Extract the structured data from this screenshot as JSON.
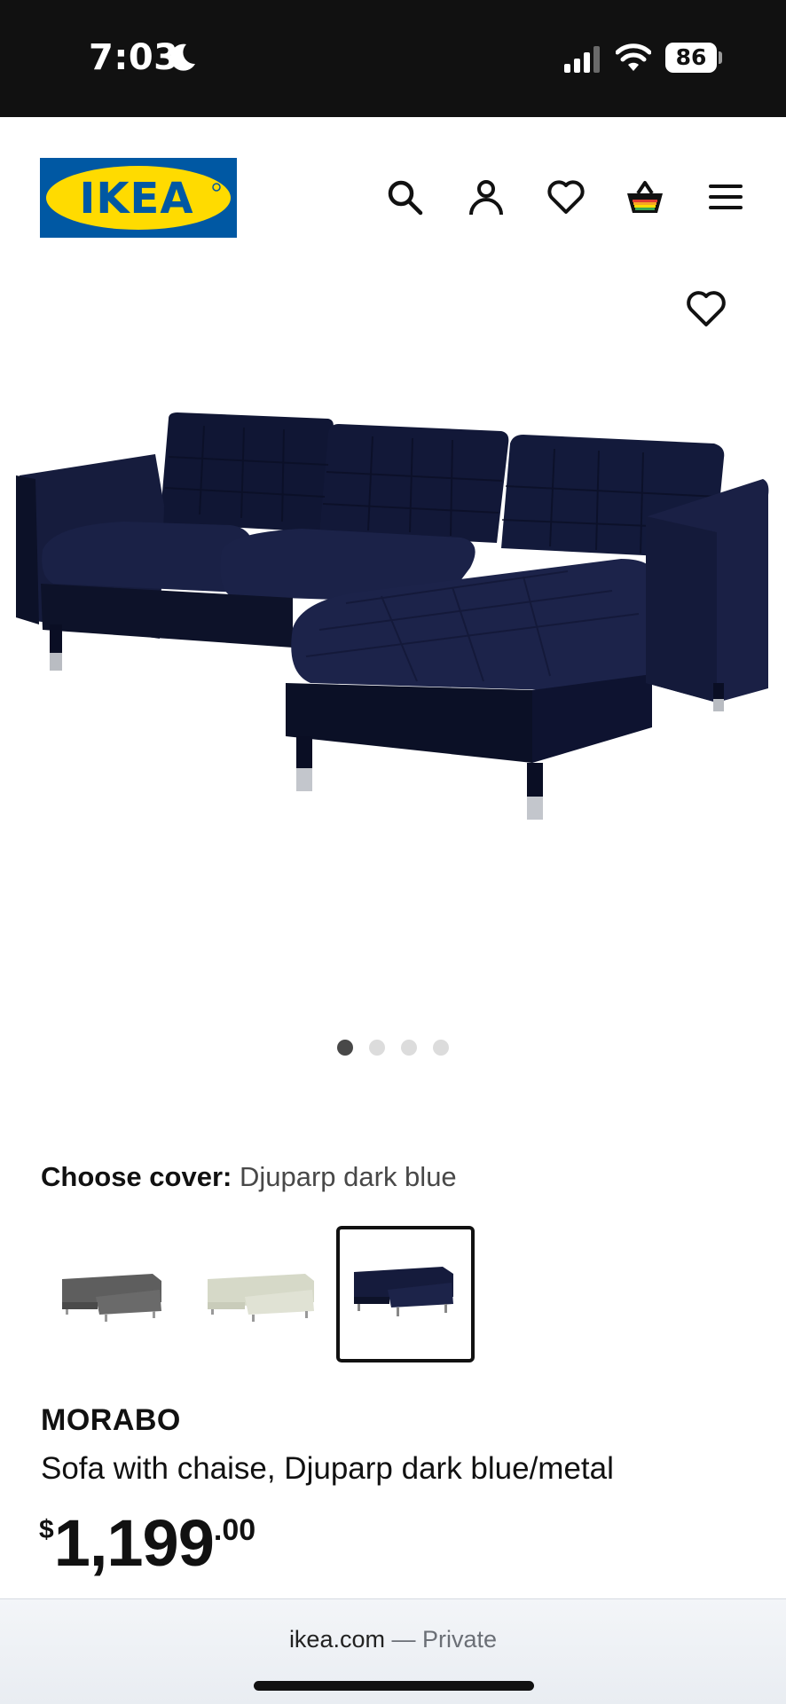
{
  "status_bar": {
    "time": "7:03",
    "battery": "86",
    "icons": [
      "moon-icon",
      "signal-icon",
      "wifi-icon",
      "battery-icon"
    ]
  },
  "header": {
    "logo_text": "IKEA",
    "icons": [
      "search-icon",
      "account-icon",
      "heart-icon",
      "cart-icon",
      "menu-icon"
    ],
    "brand_colors": {
      "blue": "#0058a3",
      "yellow": "#ffdb00"
    }
  },
  "gallery": {
    "dot_count": 4,
    "active_dot": 1,
    "favorite_icon": "heart-icon"
  },
  "cover": {
    "label": "Choose cover:",
    "value": "Djuparp dark blue",
    "options": [
      {
        "color": "#5a5a5a",
        "selected": false
      },
      {
        "color": "#d9dccc",
        "selected": false
      },
      {
        "color": "#1a1f3f",
        "selected": true
      }
    ]
  },
  "product": {
    "name": "MORABO",
    "description": "Sofa with chaise, Djuparp dark blue/metal",
    "price": {
      "currency": "$",
      "integer": "1,199",
      "decimal": ".00"
    }
  },
  "url_bar": {
    "domain": "ikea.com",
    "separator": " — ",
    "mode": "Private"
  }
}
